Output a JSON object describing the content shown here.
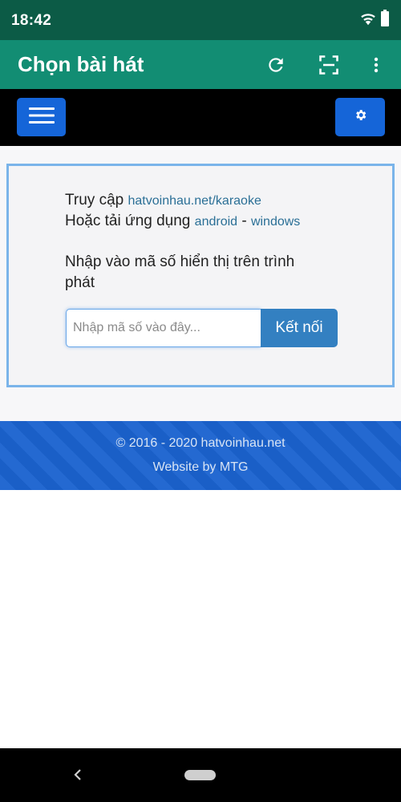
{
  "status_bar": {
    "time": "18:42",
    "icons": [
      "wifi-icon",
      "battery-icon"
    ]
  },
  "app_bar": {
    "title": "Chọn bài hát",
    "actions": [
      "refresh-icon",
      "scan-icon",
      "more-vert-icon"
    ]
  },
  "web_nav": {
    "menu_icon": "hamburger-menu-icon",
    "settings_icon": "gear-icon"
  },
  "card": {
    "line1_prefix": "Truy cập",
    "line1_link": "hatvoinhau.net/karaoke",
    "line2_prefix": "Hoặc tải ứng dụng",
    "line2_link1": "android",
    "line2_sep": "-",
    "line2_link2": "windows",
    "instruction": "Nhập vào mã số hiển thị trên trình phát",
    "input_placeholder": "Nhập mã số vào đây...",
    "input_value": "",
    "connect_label": "Kết nối"
  },
  "footer": {
    "copyright": "© 2016 - 2020 hatvoinhau.net",
    "credit": "Website by MTG"
  },
  "colors": {
    "status": "#0c5b46",
    "appbar": "#128d73",
    "button": "#1565d8",
    "footer": "#1b63cf",
    "link": "#2a6f96"
  }
}
